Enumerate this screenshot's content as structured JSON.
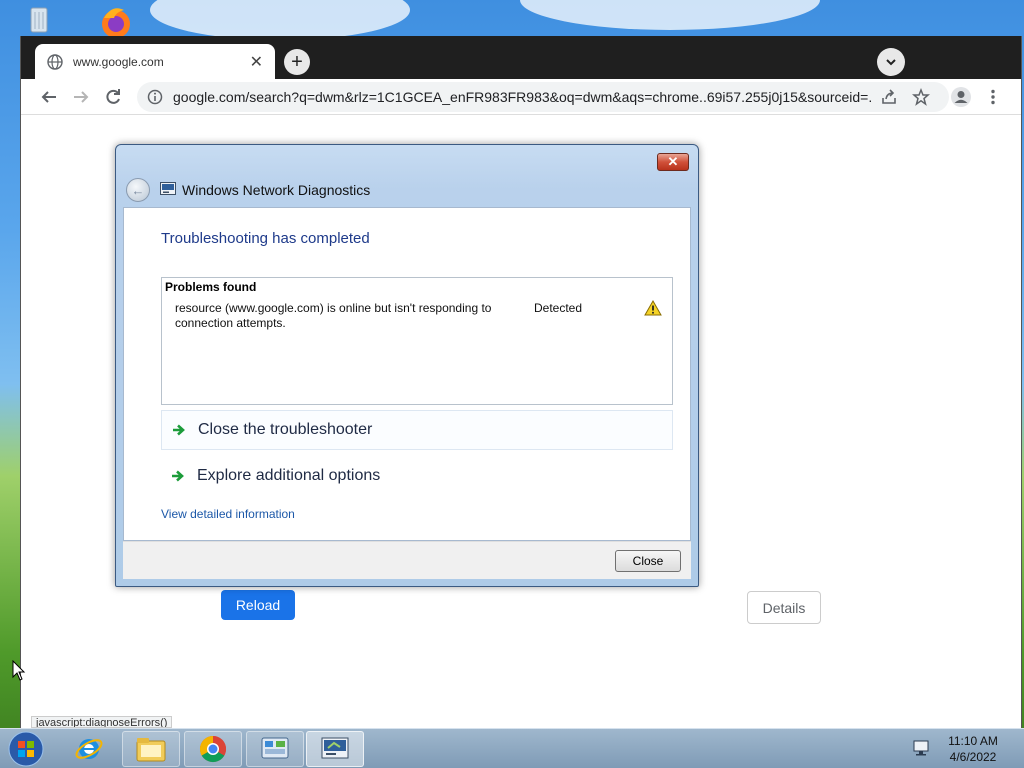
{
  "browser": {
    "tab_title": "www.google.com",
    "url": "google.com/search?q=dwm&rlz=1C1GCEA_enFR983FR983&oq=dwm&aqs=chrome..69i57.255j0j15&sourceid=...",
    "status_text": "javascript:diagnoseErrors()",
    "reload_label": "Reload",
    "details_label": "Details",
    "accent": "#1a73e8"
  },
  "dialog": {
    "title": "Windows Network Diagnostics",
    "heading": "Troubleshooting has completed",
    "problems_header": "Problems found",
    "problem_description": "resource (www.google.com) is online but isn't responding to connection attempts.",
    "problem_status": "Detected",
    "option_close": "Close the troubleshooter",
    "option_explore": "Explore additional options",
    "link_details": "View detailed information",
    "close_button": "Close"
  },
  "taskbar": {
    "time": "11:10 AM",
    "date": "4/6/2022",
    "items": [
      "internet-explorer",
      "file-explorer",
      "chrome",
      "control-panel",
      "network-diagnostics"
    ]
  }
}
